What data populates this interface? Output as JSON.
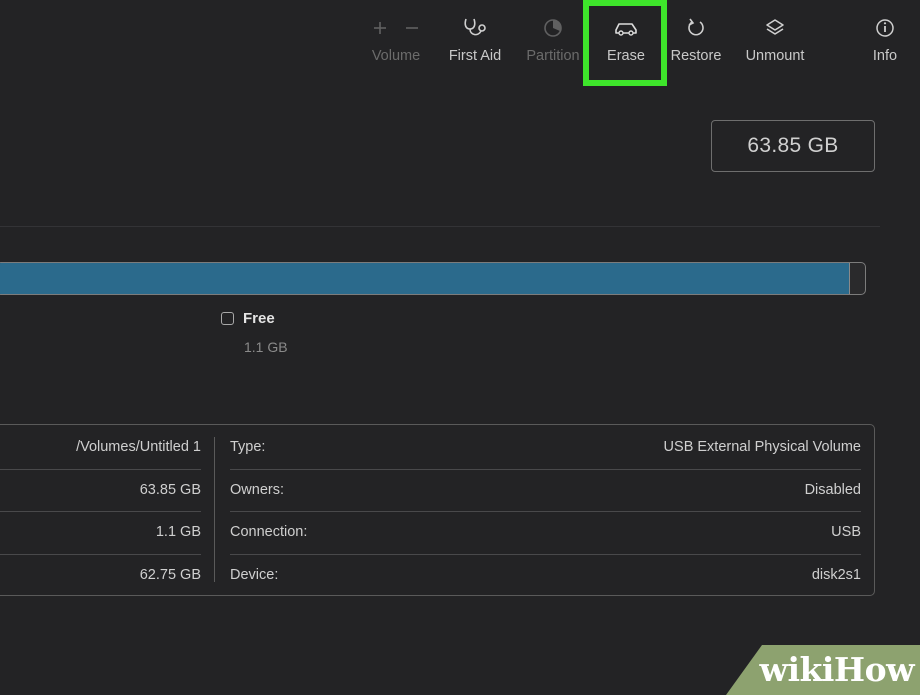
{
  "toolbar": {
    "volume": {
      "label": "Volume",
      "add_icon": "plus-icon",
      "remove_icon": "minus-icon"
    },
    "first_aid": {
      "label": "First Aid",
      "icon": "stethoscope-icon"
    },
    "partition": {
      "label": "Partition",
      "icon": "partition-pie-icon"
    },
    "erase": {
      "label": "Erase",
      "icon": "erase-car-icon"
    },
    "restore": {
      "label": "Restore",
      "icon": "restore-arrow-icon"
    },
    "unmount": {
      "label": "Unmount",
      "icon": "unmount-layers-icon"
    },
    "info": {
      "label": "Info",
      "icon": "info-icon"
    }
  },
  "capacity": "63.85 GB",
  "usage": {
    "used_fraction": 0.983,
    "free_label": "Free",
    "free_size": "1.1 GB"
  },
  "info_left": [
    {
      "value": "/Volumes/Untitled 1"
    },
    {
      "value": "63.85 GB"
    },
    {
      "value": "1.1 GB"
    },
    {
      "value": "62.75 GB"
    }
  ],
  "info_right": [
    {
      "key": "Type:",
      "value": "USB External Physical Volume"
    },
    {
      "key": "Owners:",
      "value": "Disabled"
    },
    {
      "key": "Connection:",
      "value": "USB"
    },
    {
      "key": "Device:",
      "value": "disk2s1"
    }
  ],
  "watermark": {
    "wiki": "wiki",
    "how": "How"
  },
  "colors": {
    "highlight": "#3ee52b",
    "used_bar": "#2b6a8c",
    "background": "#232325"
  }
}
